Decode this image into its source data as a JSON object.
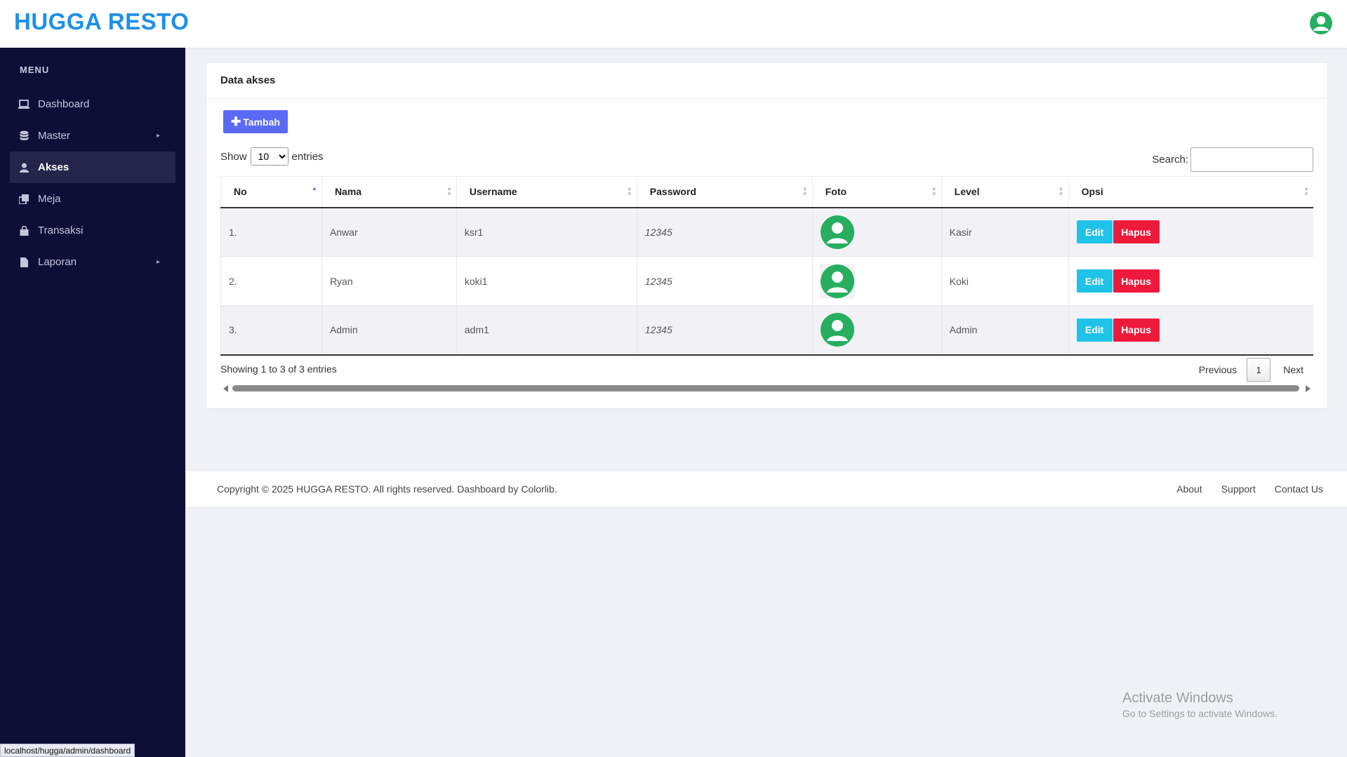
{
  "app": {
    "brand": "HUGGA RESTO"
  },
  "colors": {
    "brand": "#1e90e8",
    "sidebar_bg": "#0f0e36",
    "add_button": "#5b6af4",
    "edit_button": "#1fc3e8",
    "delete_button": "#ee1a3c",
    "avatar": "#27ae60"
  },
  "sidebar": {
    "menu_title": "MENU",
    "items": [
      {
        "label": "Dashboard",
        "icon": "laptop-icon",
        "active": false,
        "has_children": false
      },
      {
        "label": "Master",
        "icon": "database-icon",
        "active": false,
        "has_children": true
      },
      {
        "label": "Akses",
        "icon": "user-icon",
        "active": true,
        "has_children": false
      },
      {
        "label": "Meja",
        "icon": "clone-icon",
        "active": false,
        "has_children": false
      },
      {
        "label": "Transaksi",
        "icon": "shopping-bag-icon",
        "active": false,
        "has_children": false
      },
      {
        "label": "Laporan",
        "icon": "file-icon",
        "active": false,
        "has_children": true
      }
    ]
  },
  "card": {
    "title": "Data akses",
    "add_button": "Tambah",
    "show_label": "Show",
    "entries_label": "entries",
    "page_length": "10",
    "search_label": "Search:",
    "search_value": ""
  },
  "table": {
    "columns": [
      "No",
      "Nama",
      "Username",
      "Password",
      "Foto",
      "Level",
      "Opsi"
    ],
    "rows": [
      {
        "no": "1.",
        "nama": "Anwar",
        "username": "ksr1",
        "password": "12345",
        "foto": "user-avatar-icon",
        "level": "Kasir"
      },
      {
        "no": "2.",
        "nama": "Ryan",
        "username": "koki1",
        "password": "12345",
        "foto": "user-avatar-icon",
        "level": "Koki"
      },
      {
        "no": "3.",
        "nama": "Admin",
        "username": "adm1",
        "password": "12345",
        "foto": "user-avatar-icon",
        "level": "Admin"
      }
    ],
    "edit_label": "Edit",
    "delete_label": "Hapus"
  },
  "pagination": {
    "info": "Showing 1 to 3 of 3 entries",
    "previous": "Previous",
    "current_page": "1",
    "next": "Next"
  },
  "footer": {
    "copyright": "Copyright © 2025 HUGGA RESTO. All rights reserved. Dashboard by Colorlib.",
    "links": [
      "About",
      "Support",
      "Contact Us"
    ]
  },
  "os_overlay": {
    "activate_title": "Activate Windows",
    "activate_sub": "Go to Settings to activate Windows."
  },
  "status_bar": {
    "url": "localhost/hugga/admin/dashboard"
  }
}
